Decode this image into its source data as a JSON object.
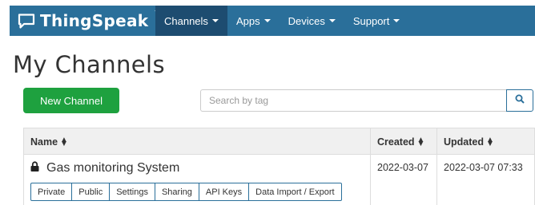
{
  "navbar": {
    "brand": "ThingSpeak",
    "brand_tm": "™",
    "items": [
      {
        "label": "Channels",
        "active": true
      },
      {
        "label": "Apps",
        "active": false
      },
      {
        "label": "Devices",
        "active": false
      },
      {
        "label": "Support",
        "active": false
      }
    ]
  },
  "page": {
    "title": "My Channels"
  },
  "toolbar": {
    "new_channel_label": "New Channel"
  },
  "search": {
    "placeholder": "Search by tag",
    "value": ""
  },
  "table": {
    "headers": {
      "name": "Name",
      "created": "Created",
      "updated": "Updated"
    },
    "rows": [
      {
        "name": "Gas monitoring System",
        "created": "2022-03-07",
        "updated": "2022-03-07 07:33",
        "actions": [
          "Private",
          "Public",
          "Settings",
          "Sharing",
          "API Keys",
          "Data Import / Export"
        ]
      }
    ]
  },
  "colors": {
    "navbar": "#2a6f9a",
    "navbar_active": "#1d4c70",
    "new_channel": "#1ea13f"
  },
  "icons": {
    "brand": "speech-bubble-icon",
    "search": "search-icon",
    "lock": "lock-icon",
    "sort": "sort-icon"
  }
}
